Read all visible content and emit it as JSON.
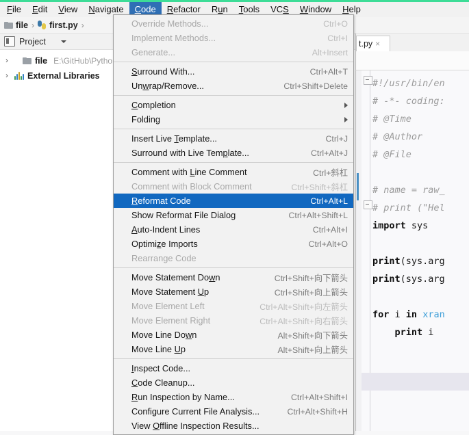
{
  "window": {
    "accent_green": "#3ddc97",
    "menu_highlight": "#2f6fb5",
    "item_highlight": "#1168c0"
  },
  "menubar": {
    "items": [
      {
        "label": "File",
        "mnemonic": "F",
        "active": false
      },
      {
        "label": "Edit",
        "mnemonic": "E",
        "active": false
      },
      {
        "label": "View",
        "mnemonic": "V",
        "active": false
      },
      {
        "label": "Navigate",
        "mnemonic": "N",
        "active": false
      },
      {
        "label": "Code",
        "mnemonic": "C",
        "active": true
      },
      {
        "label": "Refactor",
        "mnemonic": "R",
        "active": false
      },
      {
        "label": "Run",
        "mnemonic": "u",
        "active": false
      },
      {
        "label": "Tools",
        "mnemonic": "T",
        "active": false
      },
      {
        "label": "VCS",
        "mnemonic": "S",
        "active": false
      },
      {
        "label": "Window",
        "mnemonic": "W",
        "active": false
      },
      {
        "label": "Help",
        "mnemonic": "H",
        "active": false
      }
    ]
  },
  "breadcrumb": {
    "items": [
      "file",
      "first.py"
    ],
    "separator": "›"
  },
  "project_panel": {
    "title": "Project",
    "tree": [
      {
        "twisty": "›",
        "label": "file",
        "path": "E:\\GitHub\\Python-",
        "icon": "folder-icon"
      },
      {
        "twisty": "›",
        "label": "External Libraries",
        "path": "",
        "icon": "libraries-icon"
      }
    ]
  },
  "editor": {
    "tab_label": "t.py",
    "tab_close": "×",
    "lines": [
      {
        "text": "#!/usr/bin/en",
        "type": "comment",
        "fold": "top"
      },
      {
        "text": "# -*- coding:",
        "type": "comment"
      },
      {
        "text": "# @Time",
        "type": "comment"
      },
      {
        "text": "# @Author",
        "type": "comment"
      },
      {
        "text": "# @File",
        "type": "comment"
      },
      {
        "text": "",
        "type": "blank"
      },
      {
        "text": "# name = raw_",
        "type": "comment"
      },
      {
        "text": "# print (\"Hel",
        "type": "comment",
        "fold": "bottom"
      },
      {
        "text": "import sys",
        "type": "code"
      },
      {
        "text": "",
        "type": "blank"
      },
      {
        "text": "print(sys.arg",
        "type": "code"
      },
      {
        "text": "print(sys.arg",
        "type": "code"
      },
      {
        "text": "",
        "type": "blank"
      },
      {
        "text": "for i in xran",
        "type": "code"
      },
      {
        "text": "    print i",
        "type": "code"
      }
    ]
  },
  "code_menu": {
    "title": "Code",
    "items": [
      {
        "label": "Override Methods...",
        "mnemonic": "O",
        "shortcut": "Ctrl+O",
        "disabled": true,
        "submenu": false,
        "selected": false
      },
      {
        "label": "Implement Methods...",
        "mnemonic": "I",
        "shortcut": "Ctrl+I",
        "disabled": true,
        "submenu": false,
        "selected": false
      },
      {
        "label": "Generate...",
        "mnemonic": "G",
        "shortcut": "Alt+Insert",
        "disabled": true,
        "submenu": false,
        "selected": false
      },
      {
        "separator": true
      },
      {
        "label": "Surround With...",
        "mnemonic": "S",
        "shortcut": "Ctrl+Alt+T",
        "disabled": false,
        "submenu": false,
        "selected": false
      },
      {
        "label": "Unwrap/Remove...",
        "mnemonic": "w",
        "shortcut": "Ctrl+Shift+Delete",
        "disabled": false,
        "submenu": false,
        "selected": false
      },
      {
        "separator": true
      },
      {
        "label": "Completion",
        "mnemonic": "C",
        "shortcut": "",
        "disabled": false,
        "submenu": true,
        "selected": false
      },
      {
        "label": "Folding",
        "mnemonic": "",
        "shortcut": "",
        "disabled": false,
        "submenu": true,
        "selected": false
      },
      {
        "separator": true
      },
      {
        "label": "Insert Live Template...",
        "mnemonic": "T",
        "shortcut": "Ctrl+J",
        "disabled": false,
        "submenu": false,
        "selected": false
      },
      {
        "label": "Surround with Live Template...",
        "mnemonic": "p",
        "shortcut": "Ctrl+Alt+J",
        "disabled": false,
        "submenu": false,
        "selected": false
      },
      {
        "separator": true
      },
      {
        "label": "Comment with Line Comment",
        "mnemonic": "L",
        "shortcut": "Ctrl+斜杠",
        "disabled": false,
        "submenu": false,
        "selected": false
      },
      {
        "label": "Comment with Block Comment",
        "mnemonic": "B",
        "shortcut": "Ctrl+Shift+斜杠",
        "disabled": true,
        "submenu": false,
        "selected": false
      },
      {
        "label": "Reformat Code",
        "mnemonic": "R",
        "shortcut": "Ctrl+Alt+L",
        "disabled": false,
        "submenu": false,
        "selected": true
      },
      {
        "label": "Show Reformat File Dialog",
        "mnemonic": "",
        "shortcut": "Ctrl+Alt+Shift+L",
        "disabled": false,
        "submenu": false,
        "selected": false
      },
      {
        "label": "Auto-Indent Lines",
        "mnemonic": "A",
        "shortcut": "Ctrl+Alt+I",
        "disabled": false,
        "submenu": false,
        "selected": false
      },
      {
        "label": "Optimize Imports",
        "mnemonic": "z",
        "shortcut": "Ctrl+Alt+O",
        "disabled": false,
        "submenu": false,
        "selected": false
      },
      {
        "label": "Rearrange Code",
        "mnemonic": "",
        "shortcut": "",
        "disabled": true,
        "submenu": false,
        "selected": false
      },
      {
        "separator": true
      },
      {
        "label": "Move Statement Down",
        "mnemonic": "w",
        "shortcut": "Ctrl+Shift+向下箭头",
        "disabled": false,
        "submenu": false,
        "selected": false
      },
      {
        "label": "Move Statement Up",
        "mnemonic": "U",
        "shortcut": "Ctrl+Shift+向上箭头",
        "disabled": false,
        "submenu": false,
        "selected": false
      },
      {
        "label": "Move Element Left",
        "mnemonic": "",
        "shortcut": "Ctrl+Alt+Shift+向左箭头",
        "disabled": true,
        "submenu": false,
        "selected": false
      },
      {
        "label": "Move Element Right",
        "mnemonic": "",
        "shortcut": "Ctrl+Alt+Shift+向右箭头",
        "disabled": true,
        "submenu": false,
        "selected": false
      },
      {
        "label": "Move Line Down",
        "mnemonic": "w",
        "shortcut": "Alt+Shift+向下箭头",
        "disabled": false,
        "submenu": false,
        "selected": false
      },
      {
        "label": "Move Line Up",
        "mnemonic": "U",
        "shortcut": "Alt+Shift+向上箭头",
        "disabled": false,
        "submenu": false,
        "selected": false
      },
      {
        "separator": true
      },
      {
        "label": "Inspect Code...",
        "mnemonic": "I",
        "shortcut": "",
        "disabled": false,
        "submenu": false,
        "selected": false
      },
      {
        "label": "Code Cleanup...",
        "mnemonic": "C",
        "shortcut": "",
        "disabled": false,
        "submenu": false,
        "selected": false
      },
      {
        "label": "Run Inspection by Name...",
        "mnemonic": "R",
        "shortcut": "Ctrl+Alt+Shift+I",
        "disabled": false,
        "submenu": false,
        "selected": false
      },
      {
        "label": "Configure Current File Analysis...",
        "mnemonic": "",
        "shortcut": "Ctrl+Alt+Shift+H",
        "disabled": false,
        "submenu": false,
        "selected": false
      },
      {
        "label": "View Offline Inspection Results...",
        "mnemonic": "O",
        "shortcut": "",
        "disabled": false,
        "submenu": false,
        "selected": false
      }
    ]
  }
}
